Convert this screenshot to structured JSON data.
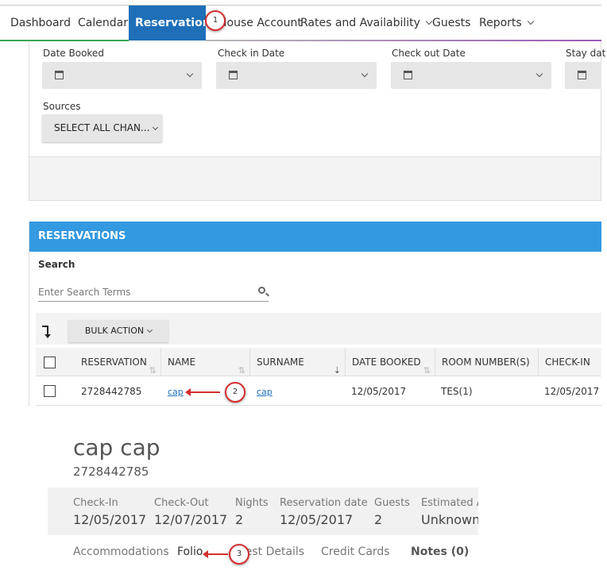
{
  "nav": {
    "items": [
      {
        "label": "Dashboard"
      },
      {
        "label": "Calendar"
      },
      {
        "label": "Reservations"
      },
      {
        "label": "House Account"
      },
      {
        "label": "Rates and Availability"
      },
      {
        "label": "Guests"
      },
      {
        "label": "Reports"
      }
    ]
  },
  "annotations": {
    "step1": "1",
    "step2": "2",
    "step3": "3"
  },
  "filters": {
    "date_booked_label": "Date Booked",
    "check_in_label": "Check in Date",
    "check_out_label": "Check out Date",
    "stay_date_label": "Stay dat",
    "sources_label": "Sources",
    "sources_value": "SELECT ALL CHAN..."
  },
  "reservations": {
    "title": "RESERVATIONS",
    "search_label": "Search",
    "search_placeholder": "Enter Search Terms",
    "bulk_action": "BULK ACTION",
    "columns": [
      "RESERVATION",
      "NAME",
      "SURNAME",
      "DATE BOOKED",
      "ROOM NUMBER(S)",
      "CHECK-IN"
    ],
    "rows": [
      {
        "reservation": "2728442785",
        "name": "cap",
        "surname": "cap",
        "date_booked": "12/05/2017",
        "rooms": "TES(1)",
        "check_in": "12/05/2017"
      }
    ]
  },
  "detail": {
    "guest_name": "cap cap",
    "reservation_number": "2728442785",
    "summary": [
      {
        "label": "Check-In",
        "value": "12/05/2017"
      },
      {
        "label": "Check-Out",
        "value": "12/07/2017"
      },
      {
        "label": "Nights",
        "value": "2"
      },
      {
        "label": "Reservation date",
        "value": "12/05/2017"
      },
      {
        "label": "Guests",
        "value": "2"
      },
      {
        "label": "Estimated A",
        "value": "Unknown"
      }
    ],
    "tabs": [
      {
        "label": "Accommodations"
      },
      {
        "label": "Folio"
      },
      {
        "label": "Guest Details"
      },
      {
        "label": "Credit Cards"
      },
      {
        "label": "Notes (0)"
      }
    ]
  },
  "colors": {
    "accent": "#1e6fb8",
    "header_blue": "#3399e0",
    "annotation_red": "#d32f2f"
  }
}
